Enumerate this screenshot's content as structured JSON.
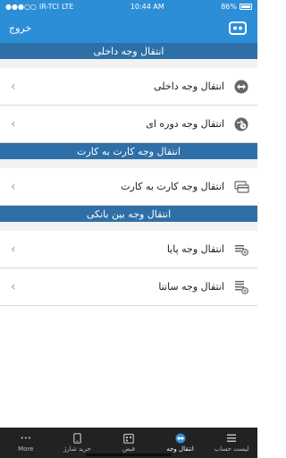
{
  "status_bar": {
    "carrier": "IR-TCI",
    "network": "LTE",
    "time": "10:44 AM",
    "battery": "86%"
  },
  "app_bar": {
    "logout_label": "خروج",
    "logo_icon": "bank-logo-icon"
  },
  "sections": [
    {
      "title": "انتقال وجه داخلی",
      "items": [
        {
          "label": "انتقال وجه داخلی",
          "icon": "transfer-arrows-icon"
        },
        {
          "label": "انتقال وجه دوره ای",
          "icon": "periodic-transfer-icon"
        }
      ]
    },
    {
      "title": "انتقال وجه کارت به کارت",
      "items": [
        {
          "label": "انتقال وجه کارت به کارت",
          "icon": "card-to-card-icon"
        }
      ]
    },
    {
      "title": "انتقال وجه بین بانکی",
      "items": [
        {
          "label": "انتقال وجه پایا",
          "icon": "paya-transfer-icon"
        },
        {
          "label": "انتقال وجه ساتنا",
          "icon": "satna-transfer-icon"
        }
      ]
    }
  ],
  "tab_bar": {
    "tabs": [
      {
        "label": "More",
        "icon": "more-dots-icon"
      },
      {
        "label": "خرید شارژ",
        "icon": "phone-topup-icon"
      },
      {
        "label": "قبض",
        "icon": "bill-icon"
      },
      {
        "label": "انتقال وجه",
        "icon": "transfer-icon",
        "active": true
      },
      {
        "label": "لیست حساب",
        "icon": "accounts-icon"
      }
    ]
  },
  "colors": {
    "primary": "#2d8ed8",
    "section": "#2e6fa8",
    "tabbar": "#222222"
  }
}
